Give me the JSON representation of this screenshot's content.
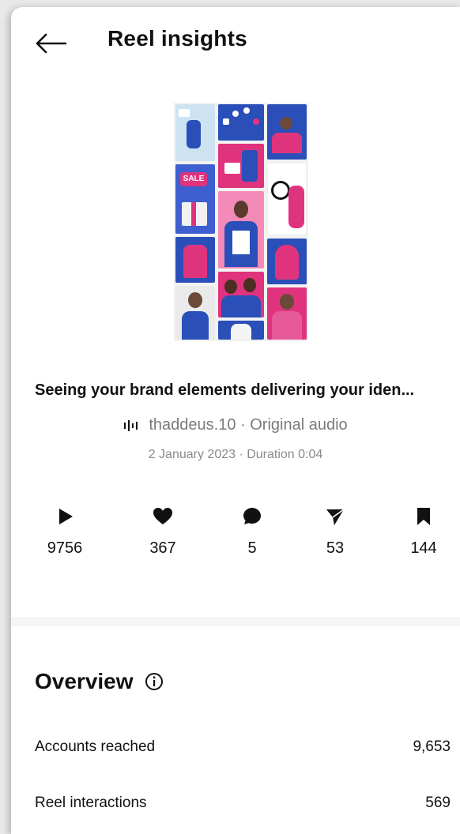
{
  "header": {
    "title": "Reel insights",
    "back_icon": "arrow-left-icon"
  },
  "reel": {
    "caption": "Seeing your brand elements delivering your iden...",
    "audio": "thaddeus.10 · Original audio",
    "audio_icon": "audio-waveform-icon",
    "meta": "2 January 2023 · Duration 0:04",
    "thumbnail_sale_text": "SALE"
  },
  "stats": [
    {
      "icon": "play-icon",
      "value": "9756"
    },
    {
      "icon": "heart-icon",
      "value": "367"
    },
    {
      "icon": "comment-icon",
      "value": "5"
    },
    {
      "icon": "share-icon",
      "value": "53"
    },
    {
      "icon": "bookmark-icon",
      "value": "144"
    }
  ],
  "overview": {
    "title": "Overview",
    "info_icon": "info-icon",
    "rows": [
      {
        "label": "Accounts reached",
        "value": "9,653"
      },
      {
        "label": "Reel interactions",
        "value": "569"
      }
    ]
  },
  "colors": {
    "accent_pink": "#e0337e",
    "accent_blue": "#2a4fb8",
    "muted_text": "#7a7a7a"
  }
}
